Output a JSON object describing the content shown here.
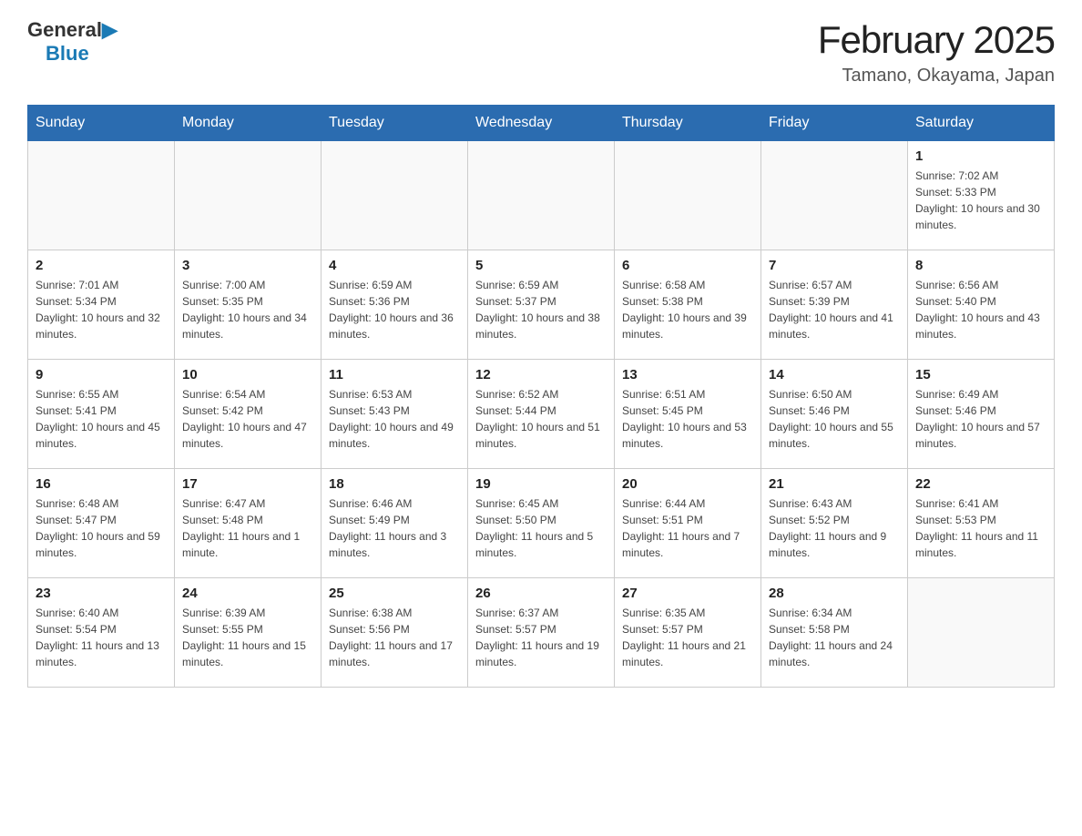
{
  "logo": {
    "general": "General",
    "blue": "Blue"
  },
  "title": "February 2025",
  "subtitle": "Tamano, Okayama, Japan",
  "days_of_week": [
    "Sunday",
    "Monday",
    "Tuesday",
    "Wednesday",
    "Thursday",
    "Friday",
    "Saturday"
  ],
  "weeks": [
    [
      {
        "day": "",
        "info": ""
      },
      {
        "day": "",
        "info": ""
      },
      {
        "day": "",
        "info": ""
      },
      {
        "day": "",
        "info": ""
      },
      {
        "day": "",
        "info": ""
      },
      {
        "day": "",
        "info": ""
      },
      {
        "day": "1",
        "info": "Sunrise: 7:02 AM\nSunset: 5:33 PM\nDaylight: 10 hours and 30 minutes."
      }
    ],
    [
      {
        "day": "2",
        "info": "Sunrise: 7:01 AM\nSunset: 5:34 PM\nDaylight: 10 hours and 32 minutes."
      },
      {
        "day": "3",
        "info": "Sunrise: 7:00 AM\nSunset: 5:35 PM\nDaylight: 10 hours and 34 minutes."
      },
      {
        "day": "4",
        "info": "Sunrise: 6:59 AM\nSunset: 5:36 PM\nDaylight: 10 hours and 36 minutes."
      },
      {
        "day": "5",
        "info": "Sunrise: 6:59 AM\nSunset: 5:37 PM\nDaylight: 10 hours and 38 minutes."
      },
      {
        "day": "6",
        "info": "Sunrise: 6:58 AM\nSunset: 5:38 PM\nDaylight: 10 hours and 39 minutes."
      },
      {
        "day": "7",
        "info": "Sunrise: 6:57 AM\nSunset: 5:39 PM\nDaylight: 10 hours and 41 minutes."
      },
      {
        "day": "8",
        "info": "Sunrise: 6:56 AM\nSunset: 5:40 PM\nDaylight: 10 hours and 43 minutes."
      }
    ],
    [
      {
        "day": "9",
        "info": "Sunrise: 6:55 AM\nSunset: 5:41 PM\nDaylight: 10 hours and 45 minutes."
      },
      {
        "day": "10",
        "info": "Sunrise: 6:54 AM\nSunset: 5:42 PM\nDaylight: 10 hours and 47 minutes."
      },
      {
        "day": "11",
        "info": "Sunrise: 6:53 AM\nSunset: 5:43 PM\nDaylight: 10 hours and 49 minutes."
      },
      {
        "day": "12",
        "info": "Sunrise: 6:52 AM\nSunset: 5:44 PM\nDaylight: 10 hours and 51 minutes."
      },
      {
        "day": "13",
        "info": "Sunrise: 6:51 AM\nSunset: 5:45 PM\nDaylight: 10 hours and 53 minutes."
      },
      {
        "day": "14",
        "info": "Sunrise: 6:50 AM\nSunset: 5:46 PM\nDaylight: 10 hours and 55 minutes."
      },
      {
        "day": "15",
        "info": "Sunrise: 6:49 AM\nSunset: 5:46 PM\nDaylight: 10 hours and 57 minutes."
      }
    ],
    [
      {
        "day": "16",
        "info": "Sunrise: 6:48 AM\nSunset: 5:47 PM\nDaylight: 10 hours and 59 minutes."
      },
      {
        "day": "17",
        "info": "Sunrise: 6:47 AM\nSunset: 5:48 PM\nDaylight: 11 hours and 1 minute."
      },
      {
        "day": "18",
        "info": "Sunrise: 6:46 AM\nSunset: 5:49 PM\nDaylight: 11 hours and 3 minutes."
      },
      {
        "day": "19",
        "info": "Sunrise: 6:45 AM\nSunset: 5:50 PM\nDaylight: 11 hours and 5 minutes."
      },
      {
        "day": "20",
        "info": "Sunrise: 6:44 AM\nSunset: 5:51 PM\nDaylight: 11 hours and 7 minutes."
      },
      {
        "day": "21",
        "info": "Sunrise: 6:43 AM\nSunset: 5:52 PM\nDaylight: 11 hours and 9 minutes."
      },
      {
        "day": "22",
        "info": "Sunrise: 6:41 AM\nSunset: 5:53 PM\nDaylight: 11 hours and 11 minutes."
      }
    ],
    [
      {
        "day": "23",
        "info": "Sunrise: 6:40 AM\nSunset: 5:54 PM\nDaylight: 11 hours and 13 minutes."
      },
      {
        "day": "24",
        "info": "Sunrise: 6:39 AM\nSunset: 5:55 PM\nDaylight: 11 hours and 15 minutes."
      },
      {
        "day": "25",
        "info": "Sunrise: 6:38 AM\nSunset: 5:56 PM\nDaylight: 11 hours and 17 minutes."
      },
      {
        "day": "26",
        "info": "Sunrise: 6:37 AM\nSunset: 5:57 PM\nDaylight: 11 hours and 19 minutes."
      },
      {
        "day": "27",
        "info": "Sunrise: 6:35 AM\nSunset: 5:57 PM\nDaylight: 11 hours and 21 minutes."
      },
      {
        "day": "28",
        "info": "Sunrise: 6:34 AM\nSunset: 5:58 PM\nDaylight: 11 hours and 24 minutes."
      },
      {
        "day": "",
        "info": ""
      }
    ]
  ]
}
